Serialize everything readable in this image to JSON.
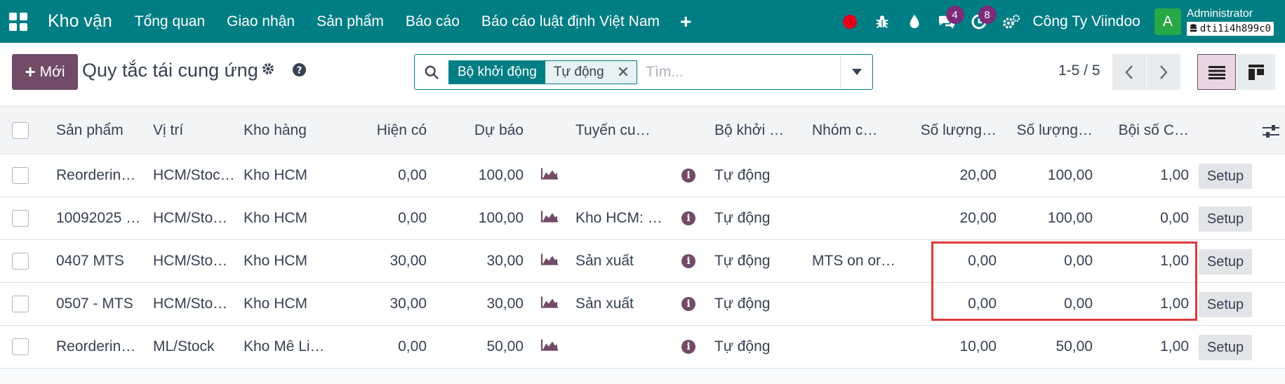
{
  "topbar": {
    "brand": "Kho vận",
    "menu": [
      "Tổng quan",
      "Giao nhận",
      "Sản phẩm",
      "Báo cáo",
      "Báo cáo luật định Việt Nam"
    ],
    "plus": "+",
    "messages_count": "4",
    "activities_count": "8",
    "company": "Công Ty Viindoo",
    "avatar_letter": "A",
    "user": "Administrator",
    "database": "dti1i4h899c0"
  },
  "control": {
    "new_label": "Mới",
    "title": "Quy tắc tái cung ứng",
    "facet_category": "Bộ khởi động",
    "facet_value": "Tự động",
    "search_placeholder": "Tìm...",
    "pager": "1-5 / 5"
  },
  "columns": {
    "product": "Sản phẩm",
    "location": "Vị trí",
    "warehouse": "Kho hàng",
    "on_hand": "Hiện có",
    "forecast": "Dự báo",
    "route": "Tuyến cu…",
    "trigger": "Bộ khởi …",
    "group": "Nhóm c…",
    "min_qty": "Số lượng…",
    "max_qty": "Số lượng…",
    "multiple": "Bội số C…"
  },
  "rows": [
    {
      "product": "Reorderin…",
      "location": "HCM/Stoc…",
      "warehouse": "Kho HCM",
      "on_hand": "0,00",
      "forecast": "100,00",
      "route": "",
      "trigger": "Tự động",
      "group": "",
      "min_qty": "20,00",
      "max_qty": "100,00",
      "multiple": "1,00",
      "setup": "Setup"
    },
    {
      "product": "10092025 …",
      "location": "HCM/Sto…",
      "warehouse": "Kho HCM",
      "on_hand": "0,00",
      "forecast": "100,00",
      "route": "Kho HCM: …",
      "trigger": "Tự động",
      "group": "",
      "min_qty": "20,00",
      "max_qty": "100,00",
      "multiple": "0,00",
      "setup": "Setup"
    },
    {
      "product": "0407 MTS",
      "location": "HCM/Sto…",
      "warehouse": "Kho HCM",
      "on_hand": "30,00",
      "forecast": "30,00",
      "route": "Sản xuất",
      "trigger": "Tự động",
      "group": "MTS on or…",
      "min_qty": "0,00",
      "max_qty": "0,00",
      "multiple": "1,00",
      "setup": "Setup"
    },
    {
      "product": "0507 - MTS",
      "location": "HCM/Sto…",
      "warehouse": "Kho HCM",
      "on_hand": "30,00",
      "forecast": "30,00",
      "route": "Sản xuất",
      "trigger": "Tự động",
      "group": "",
      "min_qty": "0,00",
      "max_qty": "0,00",
      "multiple": "1,00",
      "setup": "Setup"
    },
    {
      "product": "Reorderin…",
      "location": "ML/Stock",
      "warehouse": "Kho Mê Li…",
      "on_hand": "0,00",
      "forecast": "50,00",
      "route": "",
      "trigger": "Tự động",
      "group": "",
      "min_qty": "10,00",
      "max_qty": "50,00",
      "multiple": "1,00",
      "setup": "Setup"
    }
  ],
  "colors": {
    "topbar": "#017e84",
    "primary": "#714b67",
    "highlight": "#e03a3a"
  }
}
